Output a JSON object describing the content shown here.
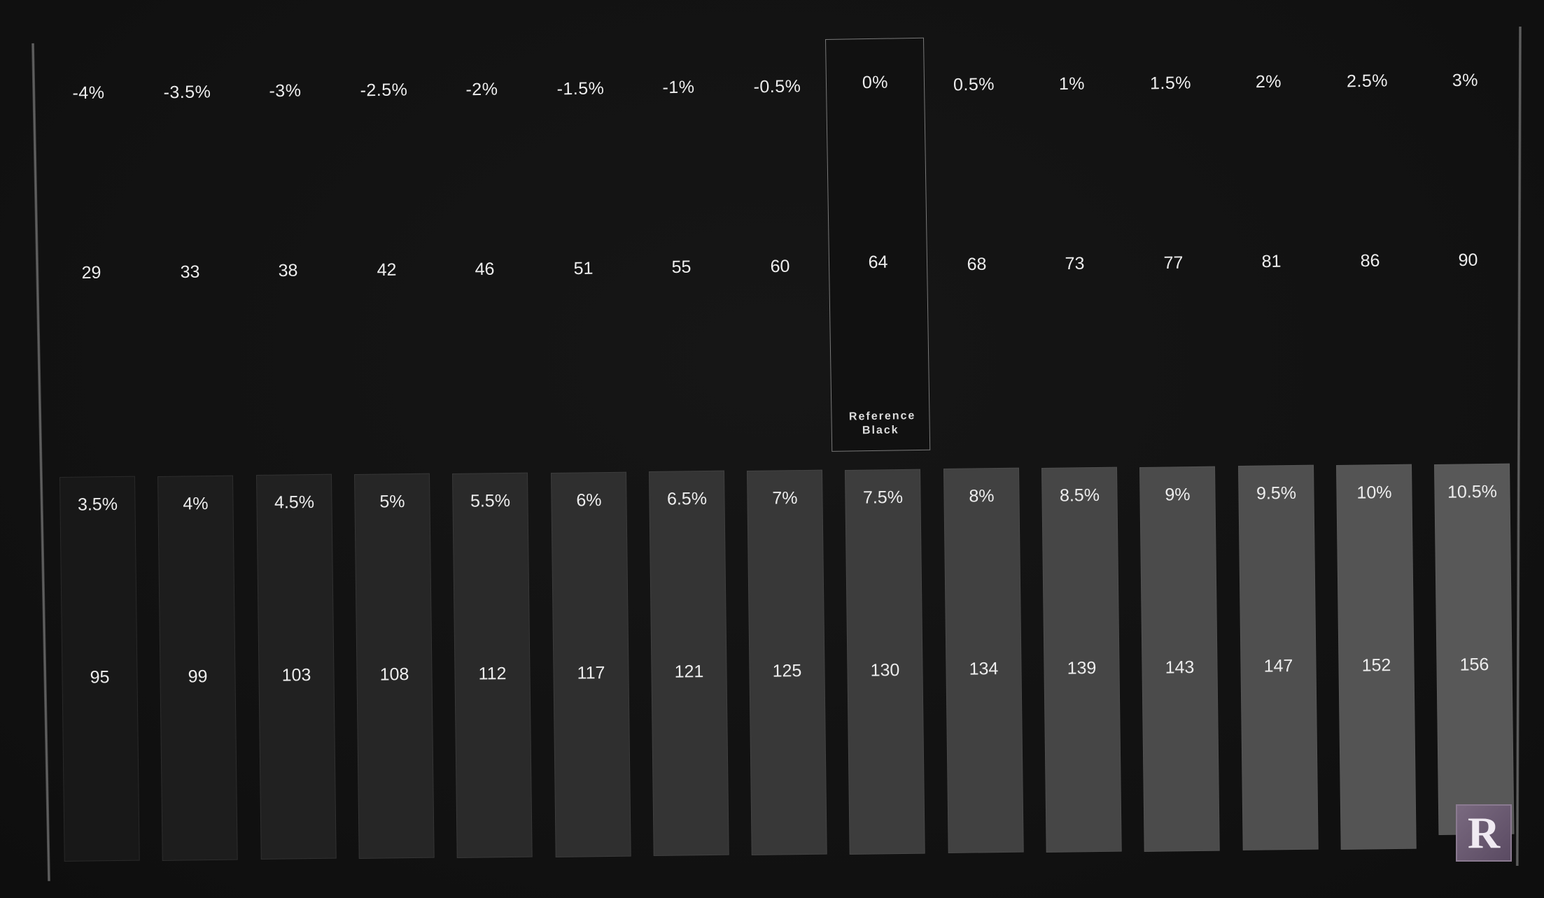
{
  "top_row": [
    {
      "pct": "-4%",
      "value": "29"
    },
    {
      "pct": "-3.5%",
      "value": "33"
    },
    {
      "pct": "-3%",
      "value": "38"
    },
    {
      "pct": "-2.5%",
      "value": "42"
    },
    {
      "pct": "-2%",
      "value": "46"
    },
    {
      "pct": "-1.5%",
      "value": "51"
    },
    {
      "pct": "-1%",
      "value": "55"
    },
    {
      "pct": "-0.5%",
      "value": "60"
    },
    {
      "pct": "0%",
      "value": "64",
      "label": "Reference Black"
    },
    {
      "pct": "0.5%",
      "value": "68"
    },
    {
      "pct": "1%",
      "value": "73"
    },
    {
      "pct": "1.5%",
      "value": "77"
    },
    {
      "pct": "2%",
      "value": "81"
    },
    {
      "pct": "2.5%",
      "value": "86"
    },
    {
      "pct": "3%",
      "value": "90"
    }
  ],
  "bottom_row": [
    {
      "pct": "3.5%",
      "value": "95"
    },
    {
      "pct": "4%",
      "value": "99"
    },
    {
      "pct": "4.5%",
      "value": "103"
    },
    {
      "pct": "5%",
      "value": "108"
    },
    {
      "pct": "5.5%",
      "value": "112"
    },
    {
      "pct": "6%",
      "value": "117"
    },
    {
      "pct": "6.5%",
      "value": "121"
    },
    {
      "pct": "7%",
      "value": "125"
    },
    {
      "pct": "7.5%",
      "value": "130"
    },
    {
      "pct": "8%",
      "value": "134"
    },
    {
      "pct": "8.5%",
      "value": "139"
    },
    {
      "pct": "9%",
      "value": "143"
    },
    {
      "pct": "9.5%",
      "value": "147"
    },
    {
      "pct": "10%",
      "value": "152"
    },
    {
      "pct": "10.5%",
      "value": "156"
    }
  ],
  "reference_index": 8,
  "logo": {
    "letter": "R",
    "icon": "r-logo-icon"
  },
  "colors": {
    "background": "#121212",
    "text": "#ededed",
    "reference_border": "#7a7a7a",
    "logo": "#6a5a72"
  }
}
